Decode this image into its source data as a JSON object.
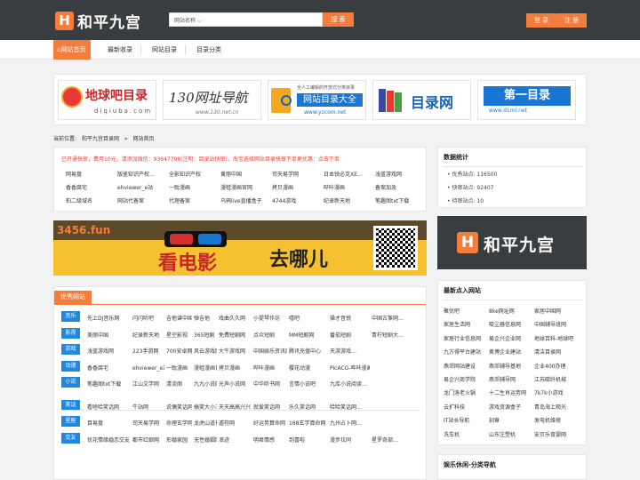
{
  "header": {
    "logo_mark": "H",
    "logo_text": "和平九宫",
    "search_select": "网站名称",
    "search_button": "搜 索",
    "login": "登 录",
    "register": "注 册"
  },
  "nav": {
    "items": [
      "网站首页",
      "最新收录",
      "网站目录",
      "目录分类"
    ]
  },
  "banners": [
    {
      "title": "地球吧目录",
      "sub": "diqiuba.com"
    },
    {
      "title": "130网址导航",
      "sub": "www.130.net.cn"
    },
    {
      "title": "网站目录大全",
      "sub": "www.yzcom.net",
      "top": "全人工编辑的开放式分类目录"
    },
    {
      "title": "目录网",
      "sub": ""
    },
    {
      "title": "第一目录",
      "sub": "www.d1ml.net"
    }
  ],
  "crumb": {
    "label": "当前位置:",
    "home": "和平九宫目录网",
    "sep": "»",
    "current": "网站首页"
  },
  "notice": {
    "text": "已开通快审，费用10元，请添加微信：93647798(注明：目录站快审)，淘宝选择网站目录快审下单更优惠：点击下单"
  },
  "quick_links": [
    [
      "网易盘",
      "版鉴知识产权…",
      "全影知识产权",
      "黄丽中国",
      "司天易学网",
      "日本锐必克XE…",
      "浅蓝游戏网"
    ],
    [
      "香香腐宅",
      "ehviewer_e站",
      "一耽漫画",
      "漫蛙漫画官网",
      "拷贝漫画",
      "哔咔漫画",
      "备案加急"
    ],
    [
      "桕二级域名",
      "网站代备案",
      "代理备案",
      "乌鸦live直播盒子",
      "4744游戏",
      "纪录新天地",
      "笔趣阁txt下载"
    ]
  ],
  "ad": {
    "domain": "3456.fun",
    "slogan1": "看电影",
    "slogan2": "去哪儿"
  },
  "stats": {
    "title": "数据统计",
    "lines": [
      "优秀站点: 116500",
      "快审站点: 92407",
      "待审站点: 10"
    ]
  },
  "dark_ad": {
    "mark": "H",
    "text": "和平九宫"
  },
  "latest": {
    "title": "最新点入网站",
    "rows": [
      [
        "聚优吧",
        "8ke网址网",
        "家居中国网"
      ],
      [
        "家居生活网",
        "吸尘器信息网",
        "中国辅导班网"
      ],
      [
        "家居行业信息网",
        "易企兴企业网",
        "地球百科-地球吧"
      ],
      [
        "九方得平台建站",
        "奥博企业建站",
        "清洁目录网"
      ],
      [
        "燕郊网站建设",
        "燕郊辅导基地",
        "企业400办理"
      ],
      [
        "易企兴商学院",
        "燕郊辅导网",
        "江苏碳纤机械"
      ],
      [
        "龙门洛老火锅",
        "十二生肖运势网",
        "7k7k小游戏"
      ],
      [
        "云扩科技",
        "游戏资源盒子",
        "青岛海上观光"
      ],
      [
        "IT站长导航",
        "刻章",
        "发电机维修"
      ],
      [
        "洗车机",
        "山东注塑机",
        "安贝乐育婴网"
      ]
    ]
  },
  "yule": {
    "title": "娱乐休闲-分类导航"
  },
  "fav": {
    "title": "优秀网站",
    "groups": [
      {
        "tag": "音乐",
        "items": [
          "先上DJ音乐网",
          "闪闪听吧",
          "吉他谱中国",
          "弹吉他",
          "戏曲久久网",
          "小提琴作坊",
          "嘻吧",
          "操才音悦",
          "中国古筝网…"
        ]
      },
      {
        "tag": "影视",
        "items": [
          "美丽中国",
          "纪录新天地",
          "星空影视",
          "365短剧",
          "免费短剧网",
          "点众短剧",
          "MM短剧网",
          "番茄短剧",
          "青柠短剧大…"
        ]
      },
      {
        "tag": "游戏",
        "items": [
          "浅蓝游戏网",
          "223手游网",
          "700安卓网",
          "风云游戏网",
          "大牛游戏网",
          "中国娱乐资讯网",
          "腾讯充值中心",
          "天游游戏…"
        ]
      },
      {
        "tag": "动漫",
        "items": [
          "香香腐宅",
          "ehviewer_e站",
          "一耽漫画",
          "漫蛙漫画官网",
          "拷贝漫画",
          "哔咔漫画",
          "樱花动漫",
          "PicACG-哔咔漫画…"
        ]
      },
      {
        "tag": "小说",
        "items": [
          "笔趣阁txt下载",
          "江山文学网",
          "清流阁",
          "九九小说网",
          "光声小说网",
          "中华听书网",
          "言情小说吧",
          "九库小说阅读…"
        ]
      },
      {
        "tag": "笑话",
        "items": [
          "看啥哈笑话网",
          "牛站网",
          "说偶笑话网",
          "搞笑大小王",
          "天天高高兴兴",
          "就爱笑话网",
          "乐久笑话网",
          "哈哈笑话网…"
        ]
      },
      {
        "tag": "星座",
        "items": [
          "目易盘",
          "司天易学网",
          "命理玄学网",
          "龙虎山道长算命",
          "遁符网",
          "好运势算命网",
          "168玄学算命网",
          "九州占卜网…"
        ]
      },
      {
        "tag": "交友",
        "items": [
          "优花情缘婚恋交友",
          "都市红娘网",
          "形婚家园",
          "无性婚姻网",
          "浪迹",
          "明君情感",
          "到喜啦",
          "漫步拉同",
          "星罗奇部…"
        ]
      }
    ]
  },
  "colors": {
    "accent": "#f47c3c",
    "header_bg": "#3a3d40",
    "tag_blue": "#1e88e5",
    "notice_red": "#e3413a"
  }
}
